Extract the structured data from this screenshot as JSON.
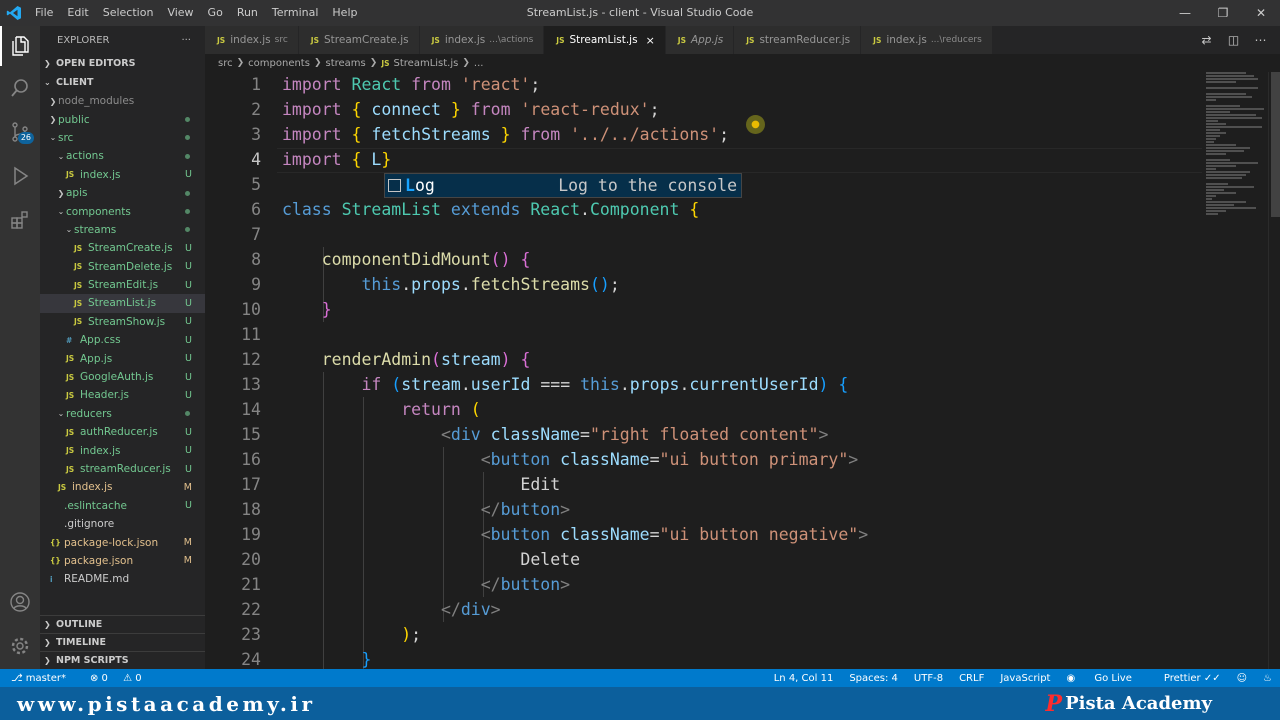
{
  "titlebar": {
    "menu": [
      "File",
      "Edit",
      "Selection",
      "View",
      "Go",
      "Run",
      "Terminal",
      "Help"
    ],
    "title": "StreamList.js - client - Visual Studio Code"
  },
  "activitybar": {
    "scm_badge": "26"
  },
  "sidebar": {
    "explorer_label": "EXPLORER",
    "more": "···",
    "open_editors": "OPEN EDITORS",
    "root": "CLIENT",
    "tree": [
      {
        "label": "node_modules",
        "kind": "folder",
        "open": false,
        "indent": 1,
        "status": ""
      },
      {
        "label": "public",
        "kind": "folder",
        "open": false,
        "indent": 1,
        "status": "dot"
      },
      {
        "label": "src",
        "kind": "folder",
        "open": true,
        "indent": 1,
        "status": "dot"
      },
      {
        "label": "actions",
        "kind": "folder",
        "open": true,
        "indent": 2,
        "status": "dot"
      },
      {
        "label": "index.js",
        "kind": "js",
        "indent": 3,
        "status": "U"
      },
      {
        "label": "apis",
        "kind": "folder",
        "open": false,
        "indent": 2,
        "status": "dot"
      },
      {
        "label": "components",
        "kind": "folder",
        "open": true,
        "indent": 2,
        "status": "dot"
      },
      {
        "label": "streams",
        "kind": "folder",
        "open": true,
        "indent": 3,
        "status": "dot"
      },
      {
        "label": "StreamCreate.js",
        "kind": "js",
        "indent": 4,
        "status": "U"
      },
      {
        "label": "StreamDelete.js",
        "kind": "js",
        "indent": 4,
        "status": "U"
      },
      {
        "label": "StreamEdit.js",
        "kind": "js",
        "indent": 4,
        "status": "U"
      },
      {
        "label": "StreamList.js",
        "kind": "js",
        "indent": 4,
        "status": "U",
        "selected": true
      },
      {
        "label": "StreamShow.js",
        "kind": "js",
        "indent": 4,
        "status": "U"
      },
      {
        "label": "App.css",
        "kind": "css",
        "indent": 3,
        "status": "U"
      },
      {
        "label": "App.js",
        "kind": "js",
        "indent": 3,
        "status": "U"
      },
      {
        "label": "GoogleAuth.js",
        "kind": "js",
        "indent": 3,
        "status": "U"
      },
      {
        "label": "Header.js",
        "kind": "js",
        "indent": 3,
        "status": "U"
      },
      {
        "label": "reducers",
        "kind": "folder",
        "open": true,
        "indent": 2,
        "status": "dot"
      },
      {
        "label": "authReducer.js",
        "kind": "js",
        "indent": 3,
        "status": "U"
      },
      {
        "label": "index.js",
        "kind": "js",
        "indent": 3,
        "status": "U"
      },
      {
        "label": "streamReducer.js",
        "kind": "js",
        "indent": 3,
        "status": "U"
      },
      {
        "label": "index.js",
        "kind": "js",
        "indent": 2,
        "status": "M"
      },
      {
        "label": ".eslintcache",
        "kind": "plain",
        "indent": 1,
        "status": "U"
      },
      {
        "label": ".gitignore",
        "kind": "plain",
        "indent": 1,
        "status": ""
      },
      {
        "label": "package-lock.json",
        "kind": "json",
        "indent": 1,
        "status": "M"
      },
      {
        "label": "package.json",
        "kind": "json",
        "indent": 1,
        "status": "M"
      },
      {
        "label": "README.md",
        "kind": "md",
        "indent": 1,
        "status": ""
      }
    ],
    "bottom_sections": [
      "OUTLINE",
      "TIMELINE",
      "NPM SCRIPTS"
    ]
  },
  "tabs": [
    {
      "label": "index.js",
      "desc": "src",
      "active": false,
      "italic": false
    },
    {
      "label": "StreamCreate.js",
      "desc": "",
      "active": false,
      "italic": false
    },
    {
      "label": "index.js",
      "desc": "...\\actions",
      "active": false,
      "italic": false
    },
    {
      "label": "StreamList.js",
      "desc": "",
      "active": true,
      "italic": false
    },
    {
      "label": "App.js",
      "desc": "",
      "active": false,
      "italic": true
    },
    {
      "label": "streamReducer.js",
      "desc": "",
      "active": false,
      "italic": false
    },
    {
      "label": "index.js",
      "desc": "...\\reducers",
      "active": false,
      "italic": false
    }
  ],
  "breadcrumb": [
    "src",
    "components",
    "streams",
    "StreamList.js",
    "..."
  ],
  "editor": {
    "lines": [
      [
        [
          "kw",
          "import "
        ],
        [
          "cls",
          "React "
        ],
        [
          "kw",
          "from "
        ],
        [
          "str",
          "'react'"
        ],
        [
          "pl",
          ";"
        ]
      ],
      [
        [
          "kw",
          "import "
        ],
        [
          "br1",
          "{ "
        ],
        [
          "id",
          "connect "
        ],
        [
          "br1",
          "} "
        ],
        [
          "kw",
          "from "
        ],
        [
          "str",
          "'react-redux'"
        ],
        [
          "pl",
          ";"
        ]
      ],
      [
        [
          "kw",
          "import "
        ],
        [
          "br1",
          "{ "
        ],
        [
          "id",
          "fetchStreams "
        ],
        [
          "br1",
          "} "
        ],
        [
          "kw",
          "from "
        ],
        [
          "str",
          "'../../actions'"
        ],
        [
          "pl",
          ";"
        ]
      ],
      [
        [
          "kw",
          "import "
        ],
        [
          "br1",
          "{ "
        ],
        [
          "id",
          "L"
        ],
        [
          "br1",
          "}"
        ]
      ],
      [],
      [
        [
          "kb",
          "class "
        ],
        [
          "cls",
          "StreamList "
        ],
        [
          "kb",
          "extends "
        ],
        [
          "cls",
          "React"
        ],
        [
          "pl",
          "."
        ],
        [
          "cls",
          "Component "
        ],
        [
          "br1",
          "{"
        ]
      ],
      [],
      [
        [
          "pl",
          "    "
        ],
        [
          "fn",
          "componentDidMount"
        ],
        [
          "br2",
          "() {"
        ]
      ],
      [
        [
          "pl",
          "        "
        ],
        [
          "kb",
          "this"
        ],
        [
          "pl",
          "."
        ],
        [
          "id",
          "props"
        ],
        [
          "pl",
          "."
        ],
        [
          "fn",
          "fetchStreams"
        ],
        [
          "br3",
          "()"
        ],
        [
          "pl",
          ";"
        ]
      ],
      [
        [
          "pl",
          "    "
        ],
        [
          "br2",
          "}"
        ]
      ],
      [],
      [
        [
          "pl",
          "    "
        ],
        [
          "fn",
          "renderAdmin"
        ],
        [
          "br2",
          "("
        ],
        [
          "id",
          "stream"
        ],
        [
          "br2",
          ") {"
        ]
      ],
      [
        [
          "pl",
          "        "
        ],
        [
          "kw",
          "if "
        ],
        [
          "br3",
          "("
        ],
        [
          "id",
          "stream"
        ],
        [
          "pl",
          "."
        ],
        [
          "id",
          "userId "
        ],
        [
          "pl",
          "=== "
        ],
        [
          "kb",
          "this"
        ],
        [
          "pl",
          "."
        ],
        [
          "id",
          "props"
        ],
        [
          "pl",
          "."
        ],
        [
          "id",
          "currentUserId"
        ],
        [
          "br3",
          ") {"
        ]
      ],
      [
        [
          "pl",
          "            "
        ],
        [
          "kw",
          "return "
        ],
        [
          "br1",
          "("
        ]
      ],
      [
        [
          "pl",
          "                "
        ],
        [
          "tag",
          "<"
        ],
        [
          "tagn",
          "div "
        ],
        [
          "attr",
          "className"
        ],
        [
          "pl",
          "="
        ],
        [
          "str",
          "\"right floated content\""
        ],
        [
          "tag",
          ">"
        ]
      ],
      [
        [
          "pl",
          "                    "
        ],
        [
          "tag",
          "<"
        ],
        [
          "tagn",
          "button "
        ],
        [
          "attr",
          "className"
        ],
        [
          "pl",
          "="
        ],
        [
          "str",
          "\"ui button primary\""
        ],
        [
          "tag",
          ">"
        ]
      ],
      [
        [
          "pl",
          "                        "
        ],
        [
          "pl",
          "Edit"
        ]
      ],
      [
        [
          "pl",
          "                    "
        ],
        [
          "tag",
          "</"
        ],
        [
          "tagn",
          "button"
        ],
        [
          "tag",
          ">"
        ]
      ],
      [
        [
          "pl",
          "                    "
        ],
        [
          "tag",
          "<"
        ],
        [
          "tagn",
          "button "
        ],
        [
          "attr",
          "className"
        ],
        [
          "pl",
          "="
        ],
        [
          "str",
          "\"ui button negative\""
        ],
        [
          "tag",
          ">"
        ]
      ],
      [
        [
          "pl",
          "                        "
        ],
        [
          "pl",
          "Delete"
        ]
      ],
      [
        [
          "pl",
          "                    "
        ],
        [
          "tag",
          "</"
        ],
        [
          "tagn",
          "button"
        ],
        [
          "tag",
          ">"
        ]
      ],
      [
        [
          "pl",
          "                "
        ],
        [
          "tag",
          "</"
        ],
        [
          "tagn",
          "div"
        ],
        [
          "tag",
          ">"
        ]
      ],
      [
        [
          "pl",
          "            "
        ],
        [
          "br1",
          ")"
        ],
        [
          "pl",
          ";"
        ]
      ],
      [
        [
          "pl",
          "        "
        ],
        [
          "br3",
          "}"
        ]
      ]
    ],
    "current_line": 4,
    "suggest": {
      "match": "L",
      "rest": "og",
      "detail": "Log to the console"
    }
  },
  "statusbar": {
    "branch": "master*",
    "problems": "0",
    "warnings": "0",
    "position": "Ln 4, Col 11",
    "spaces": "Spaces: 4",
    "encoding": "UTF-8",
    "eol": "CRLF",
    "language": "JavaScript",
    "golive": "Go Live",
    "prettier": "Prettier"
  },
  "watermark": {
    "url": "www.pistaacademy.ir",
    "logo": "P",
    "brand": "Pista Academy"
  }
}
